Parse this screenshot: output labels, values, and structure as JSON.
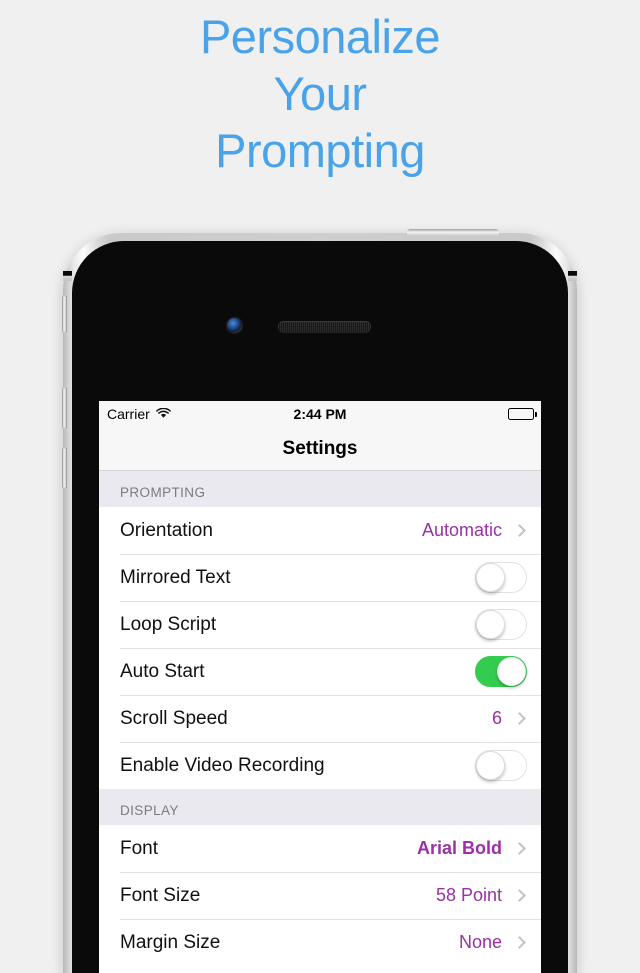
{
  "headline": {
    "lines": [
      "Personalize",
      "Your",
      "Prompting"
    ],
    "color": "#4aa3e8"
  },
  "device": {
    "name": "iphone-5s-silver",
    "icons": {
      "camera": "front-camera-icon",
      "speaker": "earpiece-speaker-icon",
      "power": "power-button",
      "mute": "silent-switch",
      "volume_up": "volume-up-button",
      "volume_down": "volume-down-button"
    }
  },
  "statusbar": {
    "carrier": "Carrier",
    "wifi_icon": "wifi-icon",
    "time": "2:44 PM",
    "battery_icon": "battery-full-icon"
  },
  "navbar": {
    "title": "Settings"
  },
  "accent": {
    "value_purple": "#9b2fa8",
    "toggle_on_green": "#33cc4e",
    "section_header_bg": "#e9e9ef"
  },
  "sections": [
    {
      "header": "PROMPTING",
      "rows": [
        {
          "label": "Orientation",
          "type": "value",
          "value": "Automatic",
          "bold": false,
          "chevron": true
        },
        {
          "label": "Mirrored Text",
          "type": "toggle",
          "on": false
        },
        {
          "label": "Loop Script",
          "type": "toggle",
          "on": false
        },
        {
          "label": "Auto Start",
          "type": "toggle",
          "on": true
        },
        {
          "label": "Scroll Speed",
          "type": "value",
          "value": "6",
          "bold": false,
          "chevron": true
        },
        {
          "label": "Enable Video Recording",
          "type": "toggle",
          "on": false
        }
      ]
    },
    {
      "header": "DISPLAY",
      "rows": [
        {
          "label": "Font",
          "type": "value",
          "value": "Arial Bold",
          "bold": true,
          "chevron": true
        },
        {
          "label": "Font Size",
          "type": "value",
          "value": "58 Point",
          "bold": false,
          "chevron": true
        },
        {
          "label": "Margin Size",
          "type": "value",
          "value": "None",
          "bold": false,
          "chevron": true
        }
      ]
    }
  ]
}
